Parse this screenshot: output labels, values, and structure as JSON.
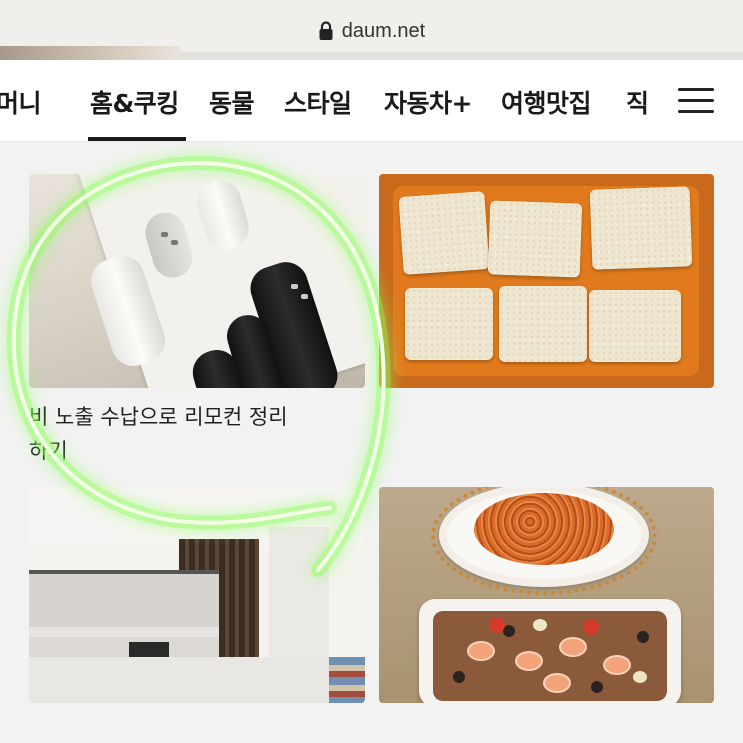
{
  "browser": {
    "url": "daum.net",
    "lock_icon": "lock-icon"
  },
  "nav": {
    "tabs": [
      {
        "label": "머니"
      },
      {
        "label": "홈&쿠킹",
        "active": true
      },
      {
        "label": "동물"
      },
      {
        "label": "스타일"
      },
      {
        "label": "자동차+"
      },
      {
        "label": "여행맛집"
      },
      {
        "label": "직"
      }
    ],
    "menu_icon": "hamburger-menu-icon"
  },
  "cards": [
    {
      "image": "remote-controls-photo",
      "caption": "비 노출 수납으로 리모컨 정리\n하기"
    },
    {
      "image": "fried-tofu-photo",
      "caption": ""
    },
    {
      "image": "kitchen-interior-photo",
      "caption": ""
    },
    {
      "image": "seafood-pasta-photo",
      "caption": ""
    }
  ],
  "colors": {
    "highlight_circle": "#7CFF4A",
    "active_underline": "#1a1a1a",
    "nav_background": "#ffffff",
    "page_background": "#f2f2f2"
  }
}
